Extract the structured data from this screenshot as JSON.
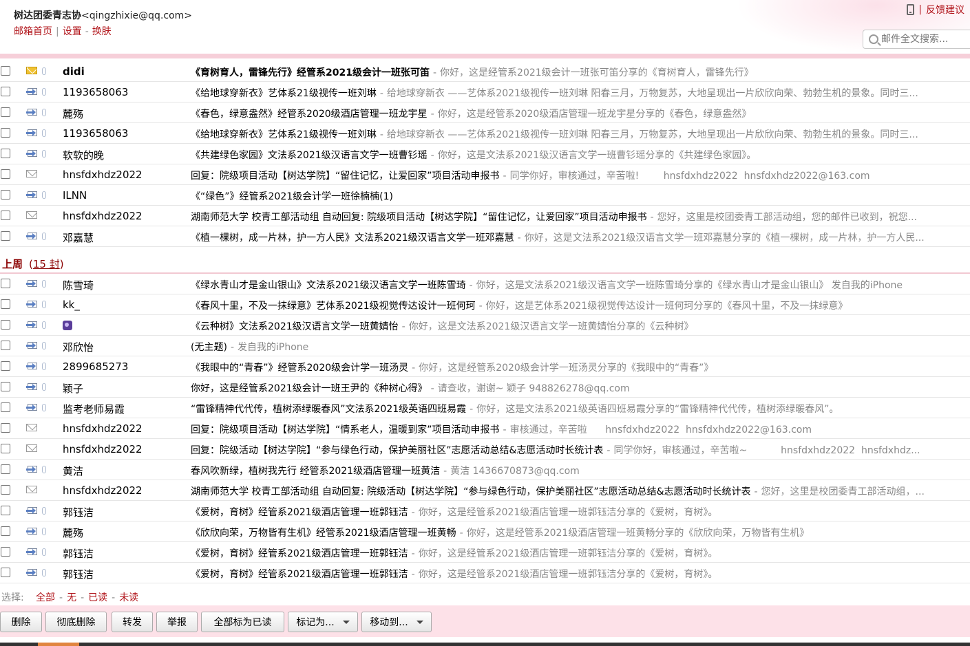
{
  "header": {
    "account_name": "树达团委青志协",
    "account_email": "<qingzhixie@qq.com>",
    "links": [
      "邮箱首页",
      "设置",
      "换肤"
    ],
    "feedback": "反馈建议",
    "search_placeholder": "邮件全文搜索..."
  },
  "mails_today": [
    {
      "icon": "unread-envelope-icon",
      "sender": "didi",
      "subject": "《育树育人，雷锋先行》经管系2021级会计一班张可笛",
      "preview": "你好，这是经管系2021级会计一班张可笛分享的《育树育人，雷锋先行》",
      "unread": true
    },
    {
      "icon": "forwarded-envelope-icon",
      "sender": "1193658063",
      "subject": "《给地球穿新衣》艺体系21级视传一班刘琳",
      "preview": "给地球穿新衣 ——艺体系2021级视传一班刘琳 阳春三月，万物复苏，大地呈现出一片欣欣向荣、勃勃生机的景象。同时三..."
    },
    {
      "icon": "forwarded-envelope-icon",
      "sender": "麓殇",
      "subject": "《春色，绿意盎然》经管系2020级酒店管理一班龙宇星",
      "preview": "你好，这是经管系2020级酒店管理一班龙宇星分享的《春色，绿意盎然》"
    },
    {
      "icon": "forwarded-envelope-icon",
      "sender": "1193658063",
      "subject": "《给地球穿新衣》艺体系21级视传一班刘琳",
      "preview": "给地球穿新衣 ——艺体系2021级视传一班刘琳 阳春三月，万物复苏，大地呈现出一片欣欣向荣、勃勃生机的景象。同时三..."
    },
    {
      "icon": "forwarded-envelope-icon",
      "sender": "软软的晚",
      "subject": "《共建绿色家园》文法系2021级汉语言文学一班曹钐瑶",
      "preview": "你好，这是文法系2021级汉语言文学一班曹钐瑶分享的《共建绿色家园》。"
    },
    {
      "icon": "read-envelope-icon",
      "sender": "hnsfdxhdz2022",
      "subject": "回复：院级项目活动【树达学院】“留住记忆，让爱回家”项目活动申报书",
      "preview": "同学你好，审核通过，辛苦啦!        hnsfdxhdz2022  hnsfdxhdz2022@163.com"
    },
    {
      "icon": "forwarded-envelope-icon",
      "sender": "ILNN",
      "subject": "《“绿色”》经管系2021级会计学一班徐楠楠(1)",
      "preview": ""
    },
    {
      "icon": "read-envelope-icon",
      "sender": "hnsfdxhdz2022",
      "subject": "湖南师范大学 校青工部活动组 自动回复: 院级项目活动【树达学院】“留住记忆，让爱回家”项目活动申报书",
      "preview": "您好，这里是校团委青工部活动组，您的邮件已收到，祝您..."
    },
    {
      "icon": "forwarded-envelope-icon",
      "sender": "邓嘉慧",
      "subject": "《植一棵树，成一片林，护一方人民》文法系2021级汉语言文学一班邓嘉慧",
      "preview": "你好，这是文法系2021级汉语言文学一班邓嘉慧分享的《植一棵树，成一片林，护一方人民..."
    }
  ],
  "section": {
    "label": "上周",
    "count_prefix": "(",
    "count_link": "15 封",
    "count_suffix": ")"
  },
  "mails_lastweek": [
    {
      "icon": "forwarded-envelope-icon",
      "sender": "陈雪琦",
      "subject": "《绿水青山才是金山银山》文法系2021级汉语言文学一班陈雪琦",
      "preview": "你好，这是文法系2021级汉语言文学一班陈雪琦分享的《绿水青山才是金山银山》 发自我的iPhone"
    },
    {
      "icon": "forwarded-envelope-icon",
      "sender": "kk_",
      "subject": "《春风十里，不及一抹绿意》艺体系2021级视觉传达设计一班何珂",
      "preview": "你好，这是艺体系2021级视觉传达设计一班何珂分享的《春风十里，不及一抹绿意》"
    },
    {
      "icon": "forwarded-envelope-icon",
      "sender": "",
      "avatar": true,
      "subject": "《云种树》文法系2021级汉语言文学一班黄婧怡",
      "preview": "你好，这是文法系2021级汉语言文学一班黄婧怡分享的《云种树》"
    },
    {
      "icon": "forwarded-envelope-icon",
      "sender": "邓欣怡",
      "subject": "(无主题)",
      "preview": "发自我的iPhone"
    },
    {
      "icon": "forwarded-envelope-icon",
      "sender": "2899685273",
      "subject": "《我眼中的“青春”》经管系2020级会计学一班汤灵",
      "preview": "你好，这是经管系2020级会计学一班汤灵分享的《我眼中的“青春”》"
    },
    {
      "icon": "forwarded-envelope-icon",
      "sender": "颖子",
      "subject": "你好，这是经管系2021级会计一班王尹的《种树心得》",
      "preview": "请查收，谢谢~ 颖子 948826278@qq.com"
    },
    {
      "icon": "forwarded-envelope-icon",
      "sender": "监考老师易霞",
      "subject": "“雷锋精神代代传，植树添绿暖春风”文法系2021级英语四班易霞",
      "preview": "你好，这是文法系2021级英语四班易霞分享的“雷锋精神代代传，植树添绿暖春风”。"
    },
    {
      "icon": "read-envelope-icon",
      "sender": "hnsfdxhdz2022",
      "subject": "回复：院级项目活动【树达学院】“情系老人，温暖到家”项目活动申报书",
      "preview": "审核通过，辛苦啦      hnsfdxhdz2022  hnsfdxhdz2022@163.com"
    },
    {
      "icon": "read-envelope-icon",
      "sender": "hnsfdxhdz2022",
      "subject": "回复：院级活动【树达学院】“参与绿色行动，保护美丽社区”志愿活动总结&志愿活动时长统计表",
      "preview": "同学你好，审核通过，辛苦啦~           hnsfdxhdz2022  hnsfdxhdz..."
    },
    {
      "icon": "forwarded-envelope-icon",
      "sender": "黄洁",
      "subject": "春风吹新绿，植树我先行 经管系2021级酒店管理一班黄洁",
      "preview": "黄洁 1436670873@qq.com"
    },
    {
      "icon": "read-envelope-icon",
      "sender": "hnsfdxhdz2022",
      "subject": "湖南师范大学 校青工部活动组 自动回复: 院级活动【树达学院】“参与绿色行动，保护美丽社区”志愿活动总结&志愿活动时长统计表",
      "preview": "您好，这里是校团委青工部活动组，..."
    },
    {
      "icon": "forwarded-envelope-icon",
      "sender": "郭钰洁",
      "subject": "《爱树，育树》经管系2021级酒店管理一班郭钰洁",
      "preview": "你好，这是经管系2021级酒店管理一班郭钰洁分享的《爱树，育树》。"
    },
    {
      "icon": "forwarded-envelope-icon",
      "sender": "麓殇",
      "subject": "《欣欣向荣，万物皆有生机》经管系2021级酒店管理一班黄畅",
      "preview": "你好，这是经管系2021级酒店管理一班黄畅分享的《欣欣向荣，万物皆有生机》"
    },
    {
      "icon": "forwarded-envelope-icon",
      "sender": "郭钰洁",
      "subject": "《爱树，育树》经管系2021级酒店管理一班郭钰洁",
      "preview": "你好，这是经管系2021级酒店管理一班郭钰洁分享的《爱树，育树》。"
    },
    {
      "icon": "forwarded-envelope-icon",
      "sender": "郭钰洁",
      "subject": "《爱树，育树》经管系2021级酒店管理一班郭钰洁",
      "preview": "你好，这是经管系2021级酒店管理一班郭钰洁分享的《爱树，育树》。"
    }
  ],
  "select_bar": {
    "label": "选择:",
    "options": [
      "全部",
      "无",
      "已读",
      "未读"
    ]
  },
  "toolbar": {
    "buttons": [
      "删除",
      "彻底删除",
      "转发",
      "举报",
      "全部标为已读",
      "标记为...",
      "移动到..."
    ]
  },
  "colors": {
    "accent": "#b1141a",
    "toolbar_bg": "#fde1e8",
    "stripe": "#f6cfd9"
  }
}
